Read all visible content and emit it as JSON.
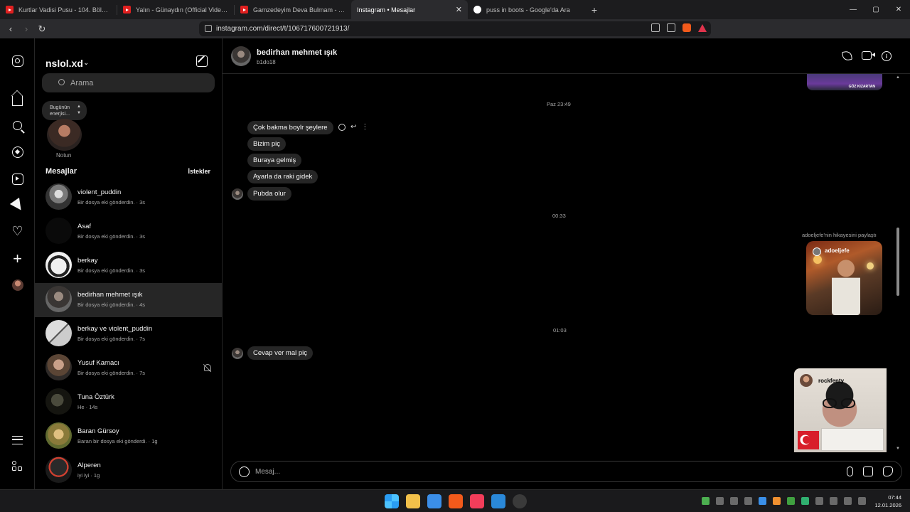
{
  "browser": {
    "tabs": [
      {
        "title": "Kurtlar Vadisi Pusu - 104. Bölüm FULL",
        "favicon": "youtube-icon",
        "active": false
      },
      {
        "title": "Yalın - Günaydın (Official Video) - You",
        "favicon": "youtube-icon",
        "active": false
      },
      {
        "title": "Gamzedeyim Deva Bulmam - YouTube",
        "favicon": "youtube-icon",
        "active": false
      },
      {
        "title": "Instagram • Mesajlar",
        "favicon": "instagram-icon",
        "active": true
      },
      {
        "title": "puss in boots - Google'da Ara",
        "favicon": "google-icon",
        "active": false
      }
    ],
    "new_tab": "+",
    "url": "instagram.com/direct/t/106717600721913/",
    "window_controls": {
      "minimize": "—",
      "maximize": "▢",
      "close": "✕"
    }
  },
  "sidebar": {
    "account": "nslol.xd",
    "search_placeholder": "Arama",
    "note_text_1": "Bugünün",
    "note_text_2": "enerjisi...",
    "note_label": "Notun",
    "messages_title": "Mesajlar",
    "requests_label": "İstekler",
    "conversations": [
      {
        "name": "violent_puddin",
        "preview": "Bir dosya eki gönderdin. · 3s",
        "muted": false,
        "selected": false
      },
      {
        "name": "Asaf",
        "preview": "Bir dosya eki gönderdin. · 3s",
        "muted": false,
        "selected": false
      },
      {
        "name": "berkay",
        "preview": "Bir dosya eki gönderdin. · 3s",
        "muted": false,
        "selected": false
      },
      {
        "name": "bedirhan mehmet ışık",
        "preview": "Bir dosya eki gönderdin. · 4s",
        "muted": false,
        "selected": true
      },
      {
        "name": "berkay ve violent_puddin",
        "preview": "Bir dosya eki gönderdin. · 7s",
        "muted": false,
        "selected": false
      },
      {
        "name": "Yusuf Kamacı",
        "preview": "Bir dosya eki gönderdin. · 7s",
        "muted": true,
        "selected": false
      },
      {
        "name": "Tuna Öztürk",
        "preview": "He · 14s",
        "muted": false,
        "selected": false
      },
      {
        "name": "Baran Gürsoy",
        "preview": "Baran bir dosya eki gönderdi. · 1g",
        "muted": false,
        "selected": false
      },
      {
        "name": "Alperen",
        "preview": "iyi iyi · 1g",
        "muted": false,
        "selected": false
      }
    ]
  },
  "chat": {
    "name": "bedirhan mehmet ışık",
    "username": "b1do18",
    "top_story_caption": "GÖZ KIZARTAN",
    "stamps": [
      "Paz 23:49",
      "00:33",
      "01:03"
    ],
    "messages": [
      "Çok bakma boylr şeylere",
      "Bizim piç",
      "Buraya gelmiş",
      "Ayarla da raki gidek",
      "Pubda olur"
    ],
    "shared_story_label": "adoeljefe'nin hikayesini paylaştı",
    "shared_story_user": "adoeljefe",
    "last_message": "Cevap ver mal piç",
    "video_user": "rockfenty",
    "composer_placeholder": "Mesaj..."
  },
  "taskbar": {
    "time": "07:44",
    "date": "12.01.2026"
  }
}
